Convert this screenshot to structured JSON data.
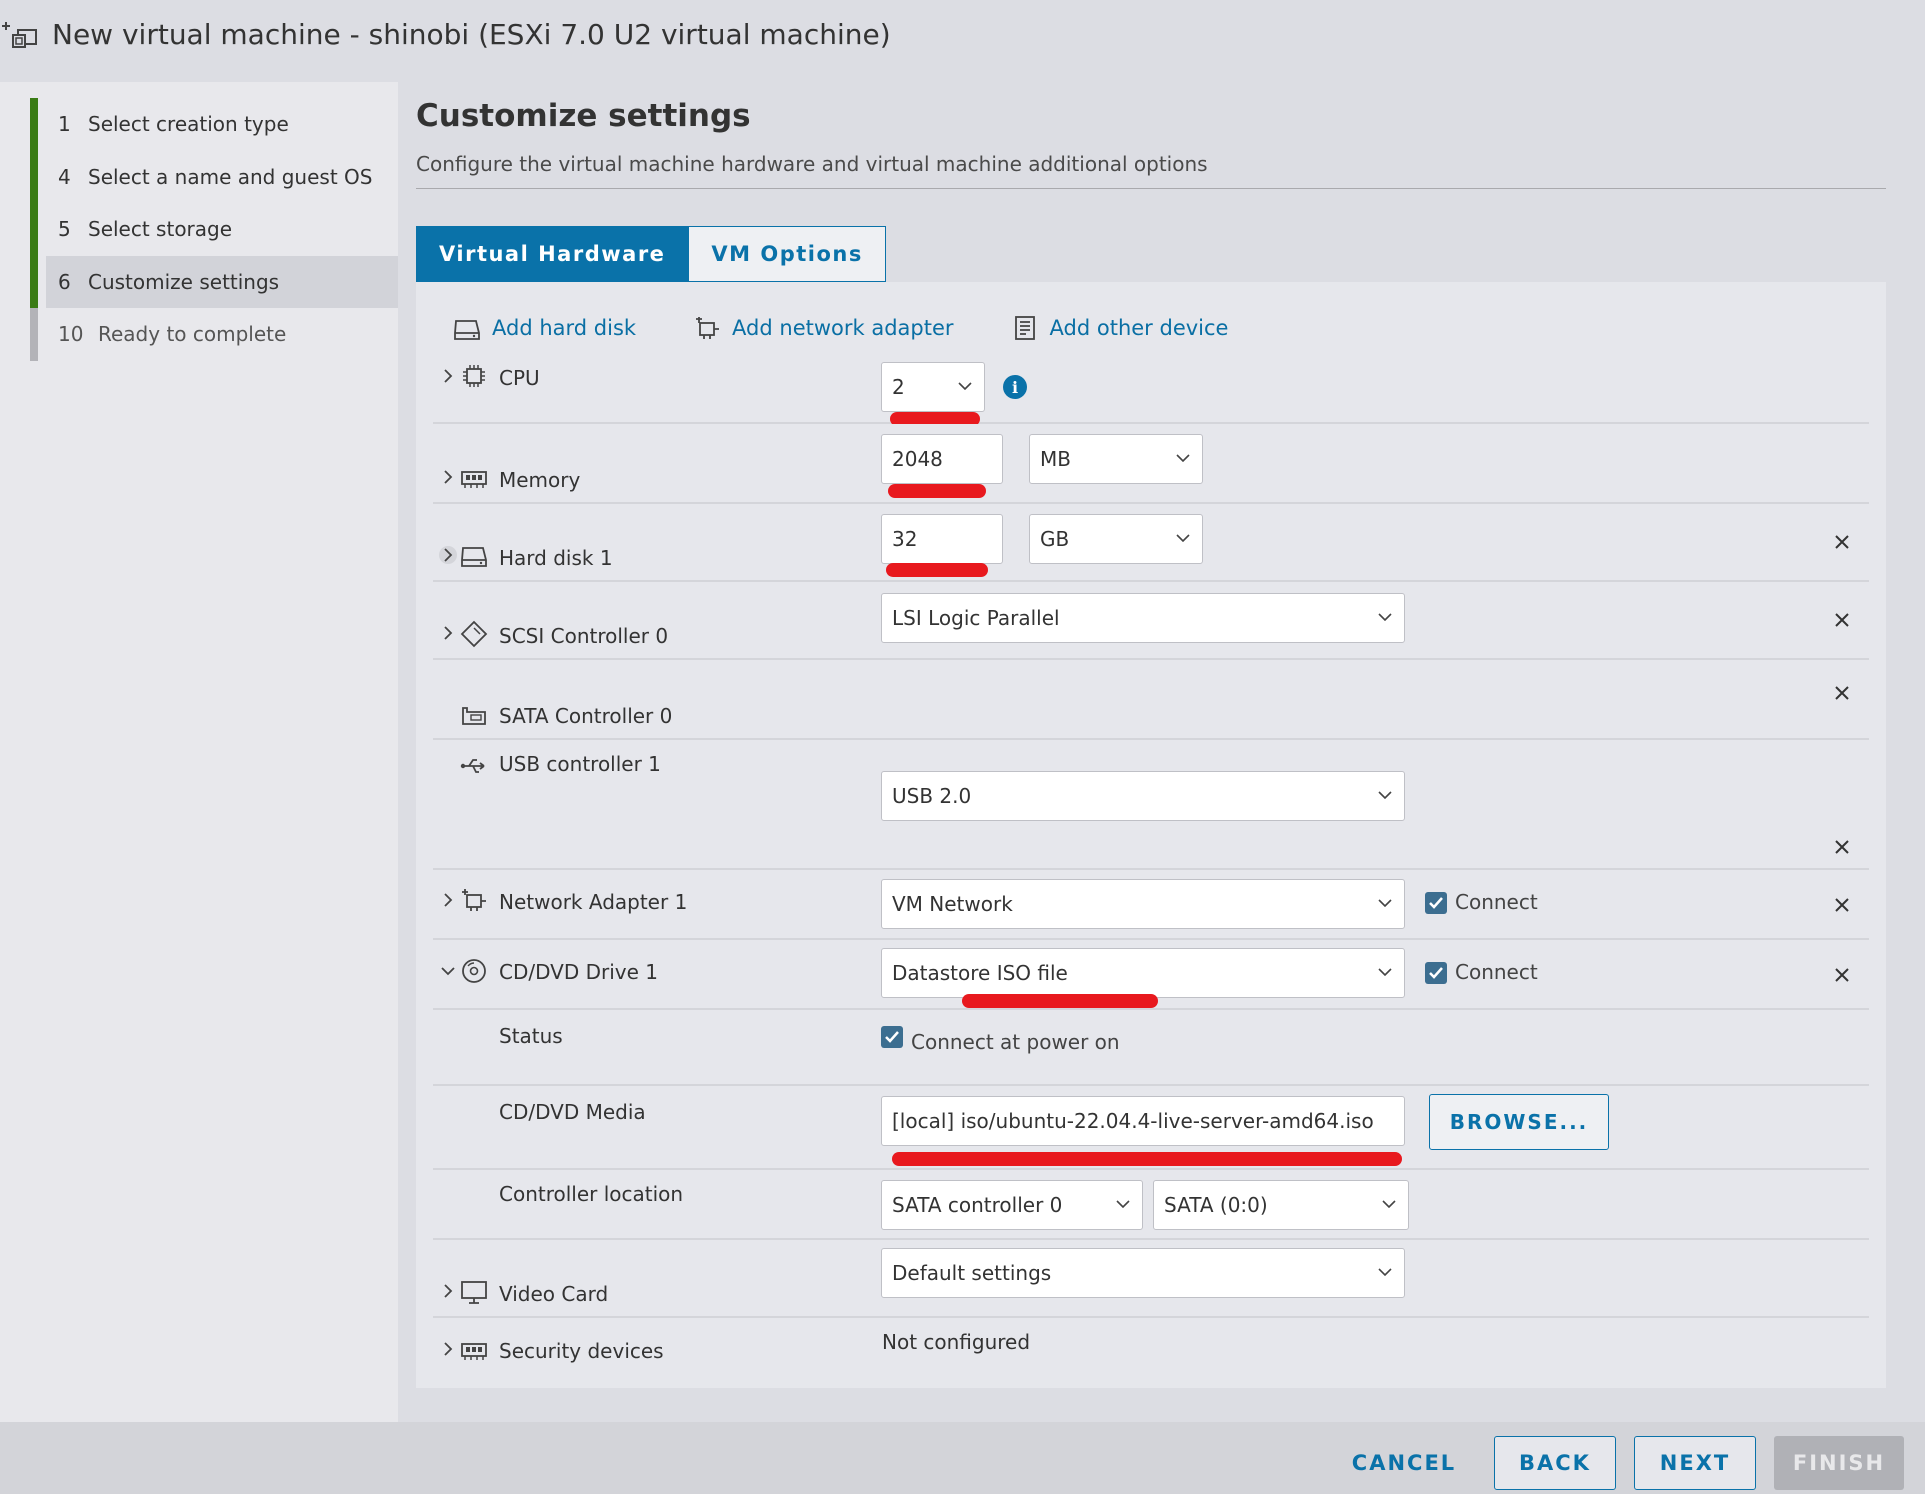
{
  "window": {
    "title": "New virtual machine - shinobi (ESXi 7.0 U2 virtual machine)"
  },
  "wizard": {
    "steps": [
      {
        "num": "1",
        "label": "Select creation type",
        "state": "done"
      },
      {
        "num": "4",
        "label": "Select a name and guest OS",
        "state": "done"
      },
      {
        "num": "5",
        "label": "Select storage",
        "state": "done"
      },
      {
        "num": "6",
        "label": "Customize settings",
        "state": "active"
      },
      {
        "num": "10",
        "label": "Ready to complete",
        "state": "pending"
      }
    ]
  },
  "page": {
    "title": "Customize settings",
    "description": "Configure the virtual machine hardware and virtual machine additional options"
  },
  "tabs": [
    {
      "label": "Virtual Hardware",
      "active": true
    },
    {
      "label": "VM Options",
      "active": false
    }
  ],
  "actions": {
    "add_hard_disk": "Add hard disk",
    "add_network_adapter": "Add network adapter",
    "add_other_device": "Add other device"
  },
  "hardware": {
    "cpu": {
      "label": "CPU",
      "value": "2"
    },
    "memory": {
      "label": "Memory",
      "value": "2048",
      "unit": "MB"
    },
    "hard_disk": {
      "label": "Hard disk 1",
      "value": "32",
      "unit": "GB"
    },
    "scsi": {
      "label": "SCSI Controller 0",
      "value": "LSI Logic Parallel"
    },
    "sata": {
      "label": "SATA Controller 0"
    },
    "usb": {
      "label": "USB controller 1",
      "value": "USB 2.0"
    },
    "network": {
      "label": "Network Adapter 1",
      "value": "VM Network",
      "connect_label": "Connect",
      "connected": true
    },
    "cddvd": {
      "label": "CD/DVD Drive 1",
      "value": "Datastore ISO file",
      "connect_label": "Connect",
      "connected": true,
      "status_label": "Status",
      "status_value": "Connect at power on",
      "media_label": "CD/DVD Media",
      "media_value": "[local] iso/ubuntu-22.04.4-live-server-amd64.iso",
      "browse_label": "BROWSE...",
      "location_label": "Controller location",
      "controller_value": "SATA controller 0",
      "slot_value": "SATA (0:0)"
    },
    "video": {
      "label": "Video Card",
      "value": "Default settings"
    },
    "security": {
      "label": "Security devices",
      "value": "Not configured"
    }
  },
  "footer": {
    "cancel": "CANCEL",
    "back": "BACK",
    "next": "NEXT",
    "finish": "FINISH"
  },
  "colors": {
    "accent": "#0a72a9",
    "step_done": "#3a7b15",
    "annotation": "#e8191e"
  }
}
